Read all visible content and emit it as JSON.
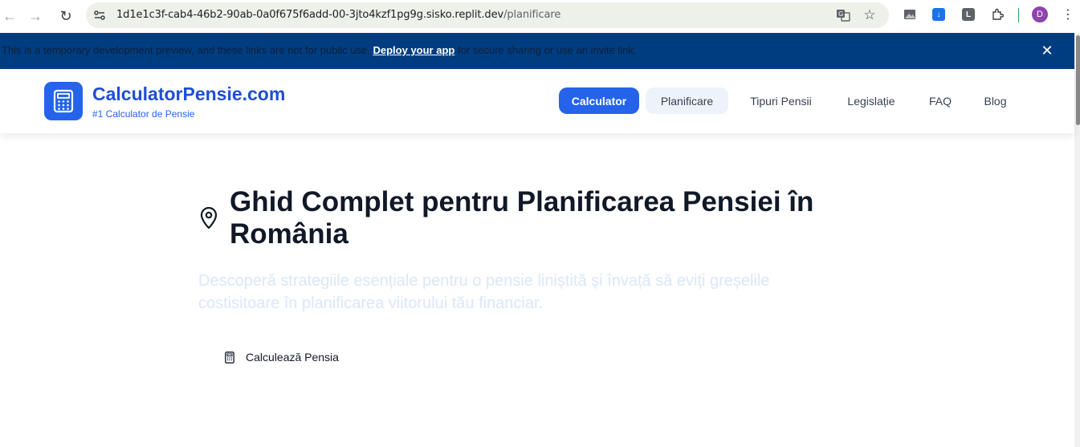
{
  "browser": {
    "url_host": "1d1e1c3f-cab4-46b2-90ab-0a0f675f6add-00-3jto4kzf1pg9g.sisko.replit.dev",
    "url_path": "/planificare",
    "profile_initial": "D",
    "ext_letter": "L"
  },
  "banner": {
    "text_before": "This is a temporary development preview, and these links are not for public use.",
    "link": "Deploy your app",
    "text_after": "for secure sharing or use an invite link."
  },
  "site": {
    "logo_title": "CalculatorPensie.com",
    "logo_subtitle": "#1 Calculator de Pensie",
    "nav": {
      "calculator": "Calculator",
      "planificare": "Planificare",
      "tipuri": "Tipuri Pensii",
      "legislatie": "Legislație",
      "faq": "FAQ",
      "blog": "Blog"
    }
  },
  "main": {
    "headline_line1": "Ghid Complet pentru Planificarea Pensiei în",
    "headline_line2": "România",
    "lead_line1": "Descoperă strategiile esențiale pentru o pensie liniștită și învață să eviți greșelile",
    "lead_line2": "costisitoare în planificarea viitorului tău financiar.",
    "cta_label": "Calculează Pensia"
  },
  "colors": {
    "brand_blue": "#2563eb",
    "banner_bg": "#003d80",
    "heading": "#111827"
  }
}
